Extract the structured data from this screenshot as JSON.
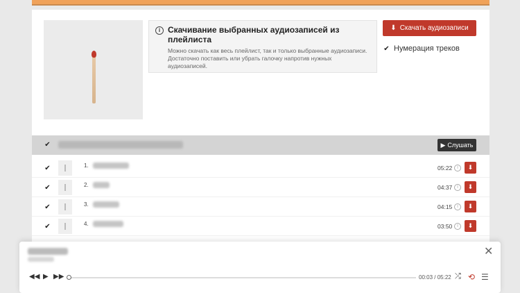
{
  "info": {
    "icon": "info-icon",
    "title": "Скачивание выбранных аудиозаписей из плейлиста",
    "text": "Можно скачать как весь плейлист, так и только выбранные аудиозаписи. Достаточно поставить или убрать галочку напротив нужных аудиозаписей."
  },
  "actions": {
    "download_label": "Скачать аудиозаписи",
    "numbering_label": "Нумерация треков",
    "numbering_checked": true
  },
  "playlist": {
    "select_all_checked": true,
    "listen_label": "Слушать"
  },
  "tracks": [
    {
      "num": "1.",
      "duration": "05:22",
      "checked": true
    },
    {
      "num": "2.",
      "duration": "04:37",
      "checked": true
    },
    {
      "num": "3.",
      "duration": "04:15",
      "checked": true
    },
    {
      "num": "4.",
      "duration": "03:50",
      "checked": true
    }
  ],
  "player": {
    "current_time": "00:03",
    "separator": "/",
    "total_time": "05:22",
    "progress_percent": 1
  },
  "colors": {
    "accent": "#c0392b",
    "banner": "#f0a25a",
    "header_bar": "#d4d4d4"
  }
}
